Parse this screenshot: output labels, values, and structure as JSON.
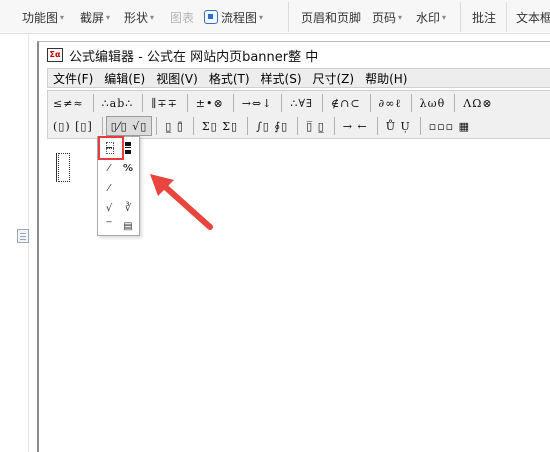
{
  "ribbon": {
    "items": [
      {
        "label": "功能图",
        "caret": "▾",
        "muted": false
      },
      {
        "label": "截屏",
        "caret": "▾",
        "muted": false
      },
      {
        "label": "形状",
        "caret": "▾",
        "muted": false
      },
      {
        "label": "图表",
        "caret": "",
        "muted": true
      },
      {
        "label": "流程图",
        "caret": "▾",
        "muted": false
      },
      {
        "label": "页眉和页脚",
        "caret": "",
        "muted": false
      },
      {
        "label": "页码",
        "caret": "▾",
        "muted": false
      },
      {
        "label": "水印",
        "caret": "▾",
        "muted": false
      },
      {
        "label": "批注",
        "caret": "",
        "muted": false
      },
      {
        "label": "文本框",
        "caret": "",
        "muted": false
      }
    ]
  },
  "equation_editor": {
    "app_icon_text": "Σα",
    "title": "公式编辑器 - 公式在 网站内页banner整   中",
    "menu": [
      "文件(F)",
      "编辑(E)",
      "视图(V)",
      "格式(T)",
      "样式(S)",
      "尺寸(Z)",
      "帮助(H)"
    ],
    "toolbar_row1": [
      "≤≠≈",
      "∴ab∴",
      "∥∓∓",
      "±•⊗",
      "→⇔↓",
      "∴∀∃",
      "∉∩⊂",
      "∂∞ℓ",
      "λωθ",
      "ΛΩ⊗"
    ],
    "toolbar_row2": [
      "(▯) [▯]",
      "▯⁄▯ √▯",
      "▯̲ ▯̄",
      "Σ▯ Σ▯",
      "∫▯ ∮▯",
      "▯̅ ▯̲",
      "→ ←",
      "Ů Ụ",
      "▫▫▫ ▦"
    ]
  },
  "palette": {
    "items": [
      "½ full",
      "½ small",
      "a/b",
      "a/b small",
      "x/y",
      "√",
      "∛",
      "long division",
      "long division 2"
    ],
    "labels": [
      "⁄",
      "%",
      "⁄",
      "√",
      "∛",
      "‾",
      "▤"
    ]
  },
  "colors": {
    "highlight": "#e83b3b",
    "arrow": "#e8453c",
    "accent": "#2f6fd0"
  }
}
